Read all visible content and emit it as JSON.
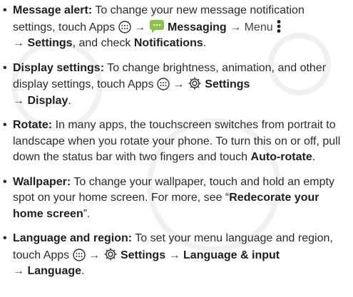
{
  "items": [
    {
      "title": "Message alert:",
      "t1": "To change your new message notification settings, touch Apps",
      "a1": "→",
      "messaging": "Messaging",
      "a2": "→ Menu",
      "a3": "→",
      "settings": "Settings",
      "t2": ", and check",
      "notifications": "Notifications",
      "t3": "."
    },
    {
      "title": "Display settings:",
      "t1": "To change brightness, animation, and other display settings, touch Apps",
      "a1": "→",
      "settings": "Settings",
      "a2": "→",
      "display": "Display",
      "t2": "."
    },
    {
      "title": "Rotate:",
      "t1": "In many apps, the touchscreen switches from portrait to landscape when you rotate your phone. To turn this on or off, pull down the status bar with two fingers and touch",
      "autorotate": "Auto-rotate",
      "t2": "."
    },
    {
      "title": "Wallpaper:",
      "t1": "To change your wallpaper, touch and hold an empty spot on your home screen. For more, see “",
      "link": "Redecorate your home screen",
      "t2": "”."
    },
    {
      "title": "Language and region:",
      "t1": "To set your menu language and region, touch Apps",
      "a1": "→",
      "settings": "Settings",
      "a2": "→",
      "langinput": "Language & input",
      "a3": "→",
      "language": "Language",
      "t2": "."
    }
  ],
  "bullet_char": "•",
  "icons": [
    "apps-icon",
    "messaging-icon",
    "menu-icon",
    "settings-gear-icon"
  ],
  "colors": {
    "text": "#2b2b2b",
    "messaging_green": "#8bc34a"
  }
}
